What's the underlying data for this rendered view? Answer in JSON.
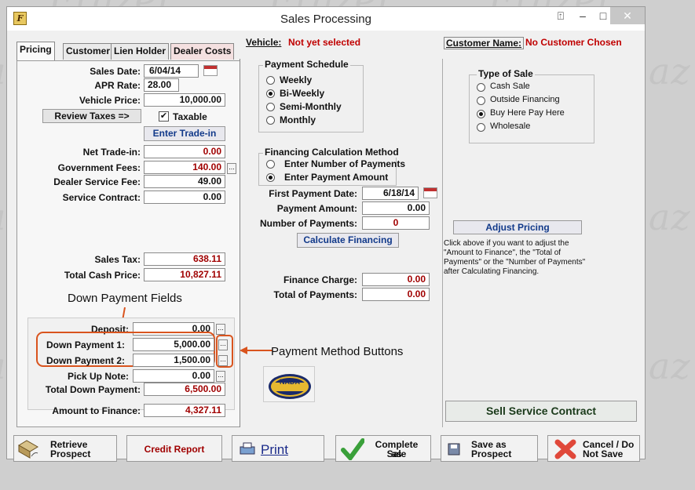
{
  "window": {
    "title": "Sales Processing",
    "app_icon": "app-icon-letter-f",
    "icon_letter": "F"
  },
  "watermark": "Frazer",
  "tabs": [
    {
      "label": "Pricing",
      "active": true
    },
    {
      "label": "Customer",
      "active": false
    },
    {
      "label": "Lien Holder",
      "active": false
    },
    {
      "label": "Dealer Costs",
      "active": false
    }
  ],
  "header": {
    "vehicle_label": "Vehicle:",
    "vehicle_value": "Not yet selected",
    "customer_label": "Customer Name:",
    "customer_value": "No Customer Chosen"
  },
  "pricing": {
    "sales_date_label": "Sales Date:",
    "sales_date": "6/04/14",
    "apr_label": "APR Rate:",
    "apr": "28.00",
    "vehicle_price_label": "Vehicle Price:",
    "vehicle_price": "10,000.00",
    "review_taxes": "Review Taxes =>",
    "taxable_label": "Taxable",
    "taxable": true,
    "enter_trade_in": "Enter Trade-in",
    "net_trade_in_label": "Net Trade-in:",
    "net_trade_in": "0.00",
    "gov_fees_label": "Government Fees:",
    "gov_fees": "140.00",
    "dealer_fee_label": "Dealer Service Fee:",
    "dealer_fee": "49.00",
    "service_contract_label": "Service Contract:",
    "service_contract": "0.00",
    "sales_tax_label": "Sales Tax:",
    "sales_tax": "638.11",
    "total_cash_label": "Total Cash Price:",
    "total_cash": "10,827.11",
    "deposit_label": "Deposit:",
    "deposit": "0.00",
    "down1_label": "Down Payment 1:",
    "down1": "5,000.00",
    "down2_label": "Down Payment 2:",
    "down2": "1,500.00",
    "pickup_label": "Pick Up Note:",
    "pickup": "0.00",
    "total_down_label": "Total Down Payment:",
    "total_down": "6,500.00",
    "amount_finance_label": "Amount to Finance:",
    "amount_finance": "4,327.11"
  },
  "payment_schedule": {
    "title": "Payment Schedule",
    "options": [
      "Weekly",
      "Bi-Weekly",
      "Semi-Monthly",
      "Monthly"
    ],
    "selected": "Bi-Weekly"
  },
  "financing_method": {
    "title": "Financing Calculation Method",
    "options": [
      "Enter Number of Payments",
      "Enter Payment Amount"
    ],
    "selected": "Enter Payment Amount"
  },
  "financing": {
    "first_payment_label": "First Payment Date:",
    "first_payment": "6/18/14",
    "payment_amount_label": "Payment Amount:",
    "payment_amount": "0.00",
    "num_payments_label": "Number of Payments:",
    "num_payments": "0",
    "calculate": "Calculate Financing",
    "finance_charge_label": "Finance Charge:",
    "finance_charge": "0.00",
    "total_payments_label": "Total of Payments:",
    "total_payments": "0.00",
    "nada_text": "NADA"
  },
  "type_of_sale": {
    "title": "Type of Sale",
    "options": [
      "Cash Sale",
      "Outside Financing",
      "Buy Here Pay Here",
      "Wholesale"
    ],
    "selected": "Buy Here Pay Here"
  },
  "adjust": {
    "button": "Adjust Pricing",
    "help_lines": [
      "Click above if you want to adjust the",
      "\"Amount to Finance\", the \"Total of",
      "Payments\" or the \"Number of Payments\"",
      "after Calculating Financing."
    ],
    "sell_service": "Sell Service Contract"
  },
  "annotations": {
    "down_payment_fields": "Down Payment Fields",
    "payment_method_buttons": "Payment Method Buttons",
    "color": "#d9541e"
  },
  "buttons": {
    "retrieve_1": "Retrieve",
    "retrieve_2": "Prospect",
    "credit_report": "Credit Report",
    "print": "Print",
    "complete_1": "Complete as",
    "complete_2": "Sale",
    "save_1": "Save as",
    "save_2": "Prospect",
    "cancel_1": "Cancel / Do",
    "cancel_2": "Not Save"
  },
  "colors": {
    "value_red": "#a00000",
    "link_red": "#c00000",
    "button_blue": "#123a8a"
  }
}
